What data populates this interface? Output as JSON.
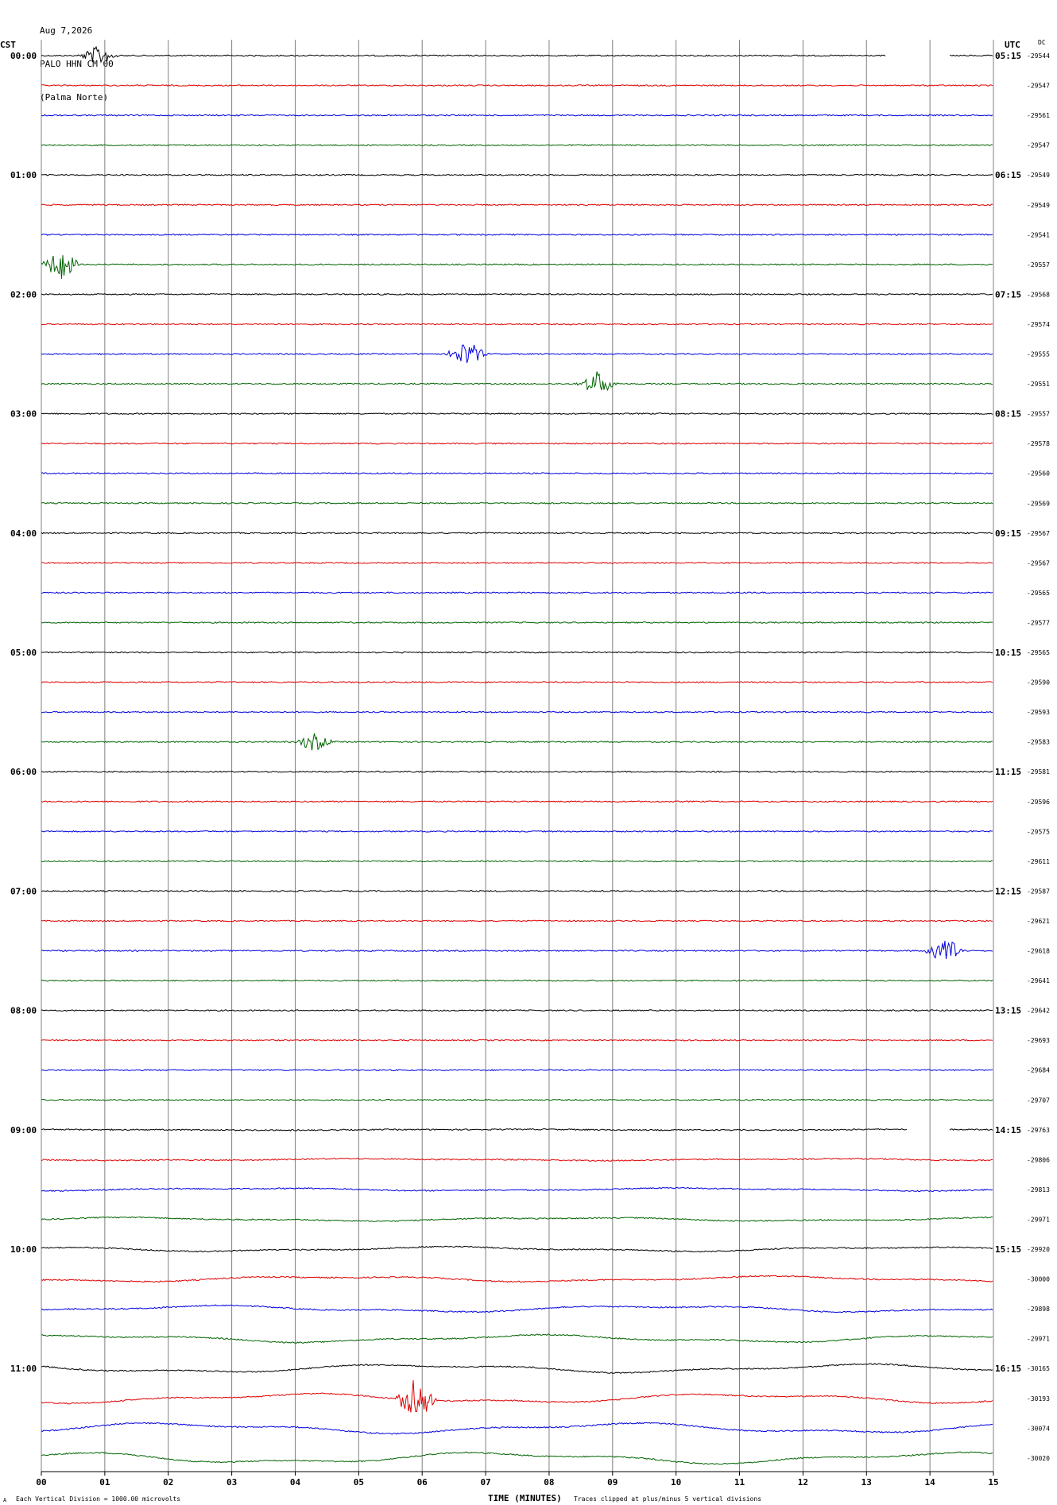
{
  "header": {
    "date": "Aug 7,2026",
    "station": "PALO HHN CM 00",
    "location": "(Palma Norte)"
  },
  "left_tz": "CST",
  "right_tz": "UTC",
  "dc_label": "DC",
  "footer": {
    "xlabel": "TIME (MINUTES)",
    "scale_note": "Each Vertical Division = 1000.00 microvolts",
    "clip_note": "Traces clipped at plus/minus 5 vertical divisions",
    "mark": "A"
  },
  "colors": {
    "cycle": [
      "#000000",
      "#e00000",
      "#0000e0",
      "#006400"
    ],
    "grid": "#808080"
  },
  "chart_data": {
    "type": "line",
    "title": "",
    "xlabel": "TIME (MINUTES)",
    "ylabel": "",
    "xlim": [
      0,
      15
    ],
    "x_ticks": [
      "00",
      "01",
      "02",
      "03",
      "04",
      "05",
      "06",
      "07",
      "08",
      "09",
      "10",
      "11",
      "12",
      "13",
      "14",
      "15"
    ],
    "grid": true,
    "rows_per_hour": 4,
    "row_count": 48,
    "left_hour_labels": [
      "00:00",
      "01:00",
      "02:00",
      "03:00",
      "04:00",
      "05:00",
      "06:00",
      "07:00",
      "08:00",
      "09:00",
      "10:00",
      "11:00"
    ],
    "right_hour_labels": [
      "05:15",
      "06:15",
      "07:15",
      "08:15",
      "09:15",
      "10:15",
      "11:15",
      "12:15",
      "13:15",
      "14:15",
      "15:15",
      "16:15"
    ],
    "dc_offsets": [
      "-29544",
      "-29547",
      "-29561",
      "-29547",
      "-29549",
      "-29549",
      "-29541",
      "-29557",
      "-29568",
      "-29574",
      "-29555",
      "-29551",
      "-29557",
      "-29578",
      "-29560",
      "-29569",
      "-29567",
      "-29567",
      "-29565",
      "-29577",
      "-29565",
      "-29590",
      "-29593",
      "-29583",
      "-29581",
      "-29596",
      "-29575",
      "-29611",
      "-29587",
      "-29621",
      "-29618",
      "-29641",
      "-29642",
      "-29693",
      "-29684",
      "-29707",
      "-29763",
      "-29806",
      "-29813",
      "-29971",
      "-29920",
      "-30000",
      "-29898",
      "-29971",
      "-30165",
      "-30193",
      "-30074",
      "-30020"
    ],
    "events": [
      {
        "row": 0,
        "minute": 0.9,
        "amplitude": 0.9
      },
      {
        "row": 7,
        "minute": 0.3,
        "amplitude": 1.4
      },
      {
        "row": 10,
        "minute": 6.7,
        "amplitude": 1.2
      },
      {
        "row": 11,
        "minute": 8.75,
        "amplitude": 1.1
      },
      {
        "row": 23,
        "minute": 4.3,
        "amplitude": 0.8
      },
      {
        "row": 30,
        "minute": 14.25,
        "amplitude": 1.2
      },
      {
        "row": 45,
        "minute": 5.9,
        "amplitude": 2.0
      }
    ],
    "gaps": [
      {
        "row": 0,
        "from": 13.3,
        "to": 14.3
      },
      {
        "row": 36,
        "from": 13.65,
        "to": 14.3
      }
    ]
  }
}
